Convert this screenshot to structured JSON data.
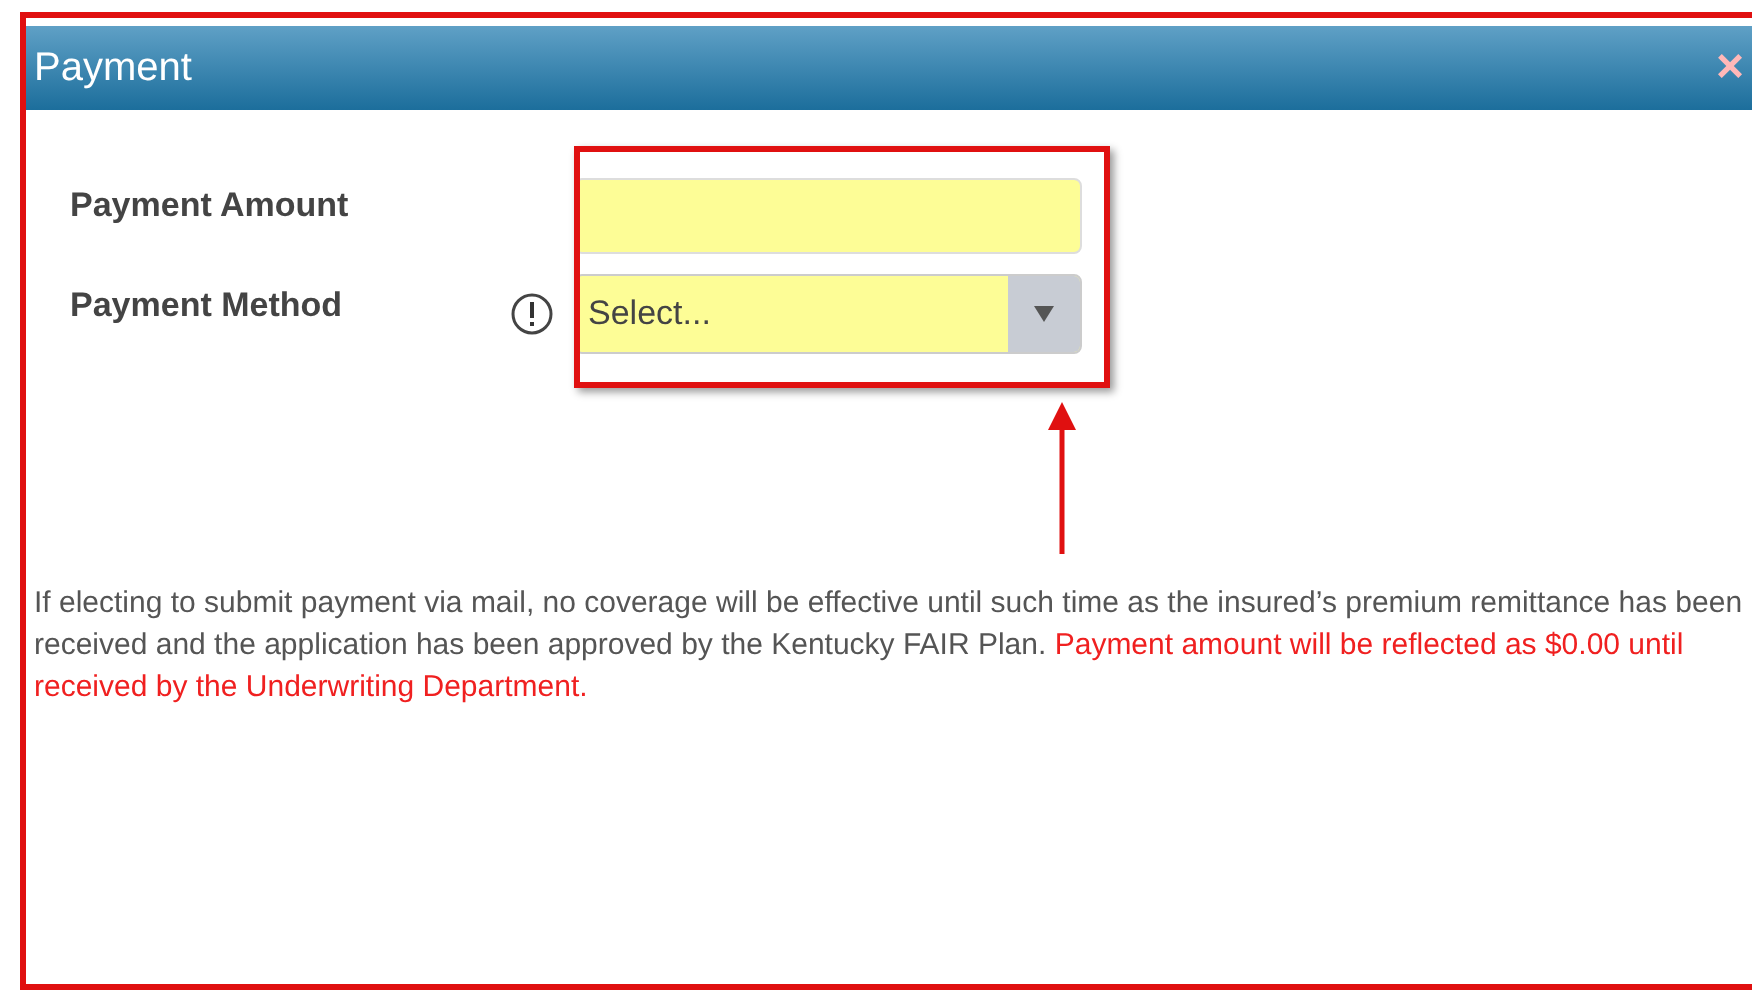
{
  "window": {
    "title": "Payment",
    "close": "×"
  },
  "fields": [
    {
      "label": "Payment Amount",
      "kind": "text"
    },
    {
      "label": "Payment Method",
      "kind": "select",
      "placeholder": "Select...",
      "required": true
    }
  ],
  "notice": {
    "text": "If electing to submit payment via mail, no coverage will be effective until such time as the insured’s premium remittance has been received and the application has been approved by the Kentucky FAIR Plan.",
    "warning": "Payment amount will be reflected as $0.00 until received by the Underwriting Department."
  }
}
